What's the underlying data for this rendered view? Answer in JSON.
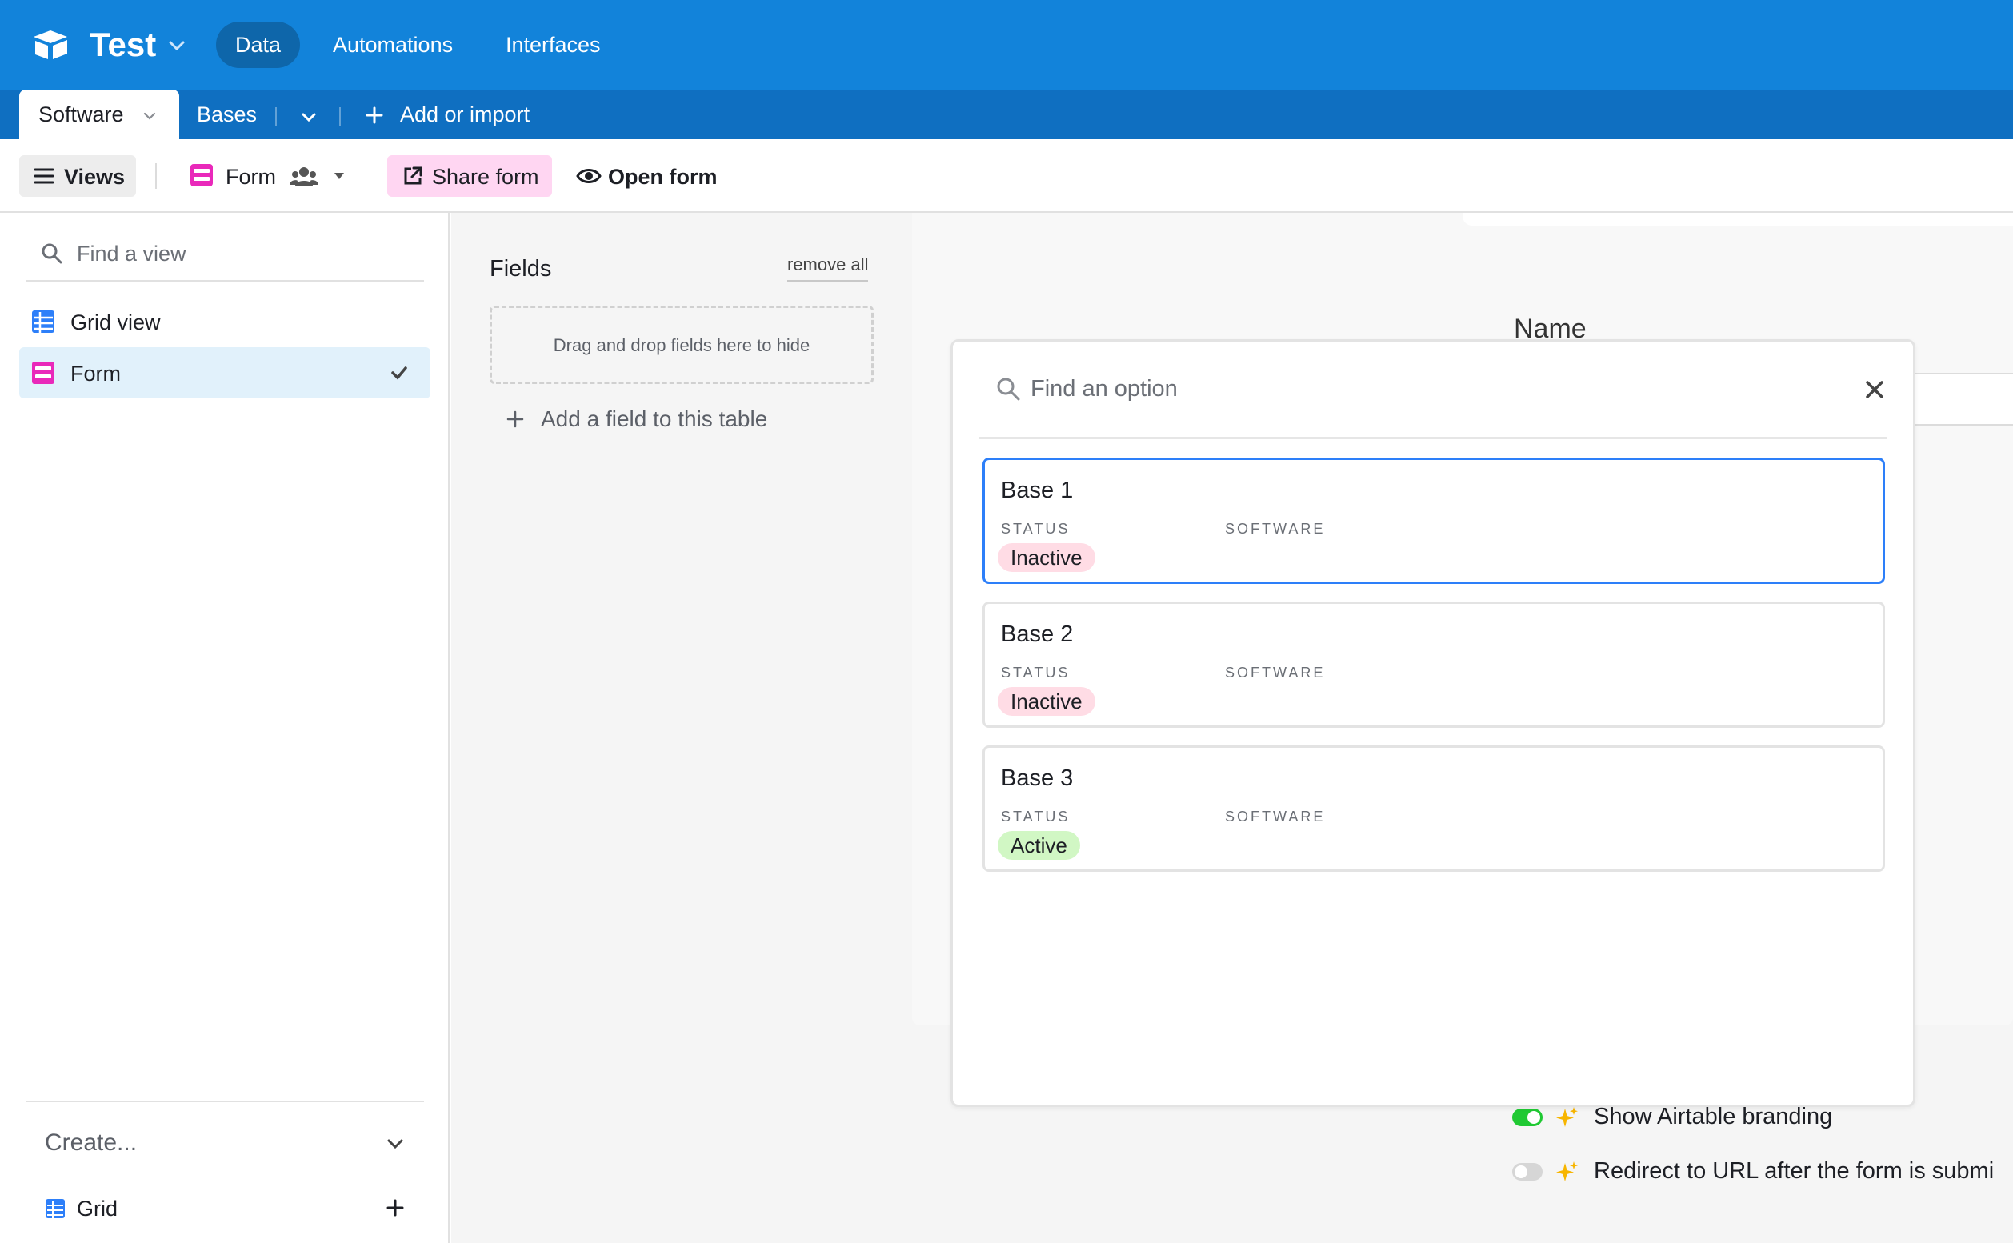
{
  "app": {
    "base_name": "Test",
    "nav": [
      {
        "label": "Data",
        "active": true
      },
      {
        "label": "Automations",
        "active": false
      },
      {
        "label": "Interfaces",
        "active": false
      }
    ]
  },
  "tables": {
    "active_tab": "Software",
    "tabs": [
      "Bases"
    ],
    "add_import_label": "Add or import"
  },
  "viewbar": {
    "views_label": "Views",
    "current_view": "Form",
    "share_label": "Share form",
    "open_label": "Open form"
  },
  "sidebar": {
    "find_placeholder": "Find a view",
    "views": [
      {
        "label": "Grid view",
        "icon": "grid-icon",
        "selected": false
      },
      {
        "label": "Form",
        "icon": "form-icon",
        "selected": true
      }
    ],
    "create_label": "Create...",
    "create_items": [
      {
        "label": "Grid",
        "icon": "grid-icon"
      }
    ]
  },
  "fields_panel": {
    "title": "Fields",
    "remove_all": "remove all",
    "drop_hint": "Drag and drop fields here to hide",
    "add_field": "Add a field to this table"
  },
  "form": {
    "field_name": "Name",
    "settings": [
      {
        "label": "Show Airtable branding",
        "enabled": true
      },
      {
        "label": "Redirect to URL after the form is submi",
        "enabled": false
      }
    ]
  },
  "picker": {
    "search_placeholder": "Find an option",
    "status_label": "STATUS",
    "software_label": "SOFTWARE",
    "options": [
      {
        "title": "Base 1",
        "status": "Inactive",
        "selected": true
      },
      {
        "title": "Base 2",
        "status": "Inactive",
        "selected": false
      },
      {
        "title": "Base 3",
        "status": "Active",
        "selected": false
      }
    ]
  },
  "colors": {
    "header_blue": "#1283da",
    "tabbar_blue": "#0f6fc1",
    "form_pink": "#e929ba",
    "grid_blue": "#2d7ff9",
    "inactive_badge": "#ffdce5",
    "active_badge": "#d1f7c4",
    "toggle_on": "#20c933"
  }
}
